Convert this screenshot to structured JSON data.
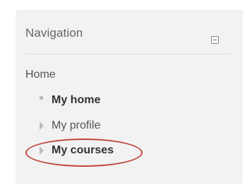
{
  "navigation": {
    "title": "Navigation",
    "root_label": "Home",
    "items": [
      {
        "label": "My home",
        "bullet": "square-bullet-icon",
        "bold": true
      },
      {
        "label": "My profile",
        "bullet": "triangle-bullet-icon",
        "bold": false
      },
      {
        "label": "My courses",
        "bullet": "triangle-bullet-icon",
        "bold": true
      }
    ]
  },
  "colors": {
    "panel_background": "#f2f2f2",
    "highlight_ring": "#c0433f"
  }
}
